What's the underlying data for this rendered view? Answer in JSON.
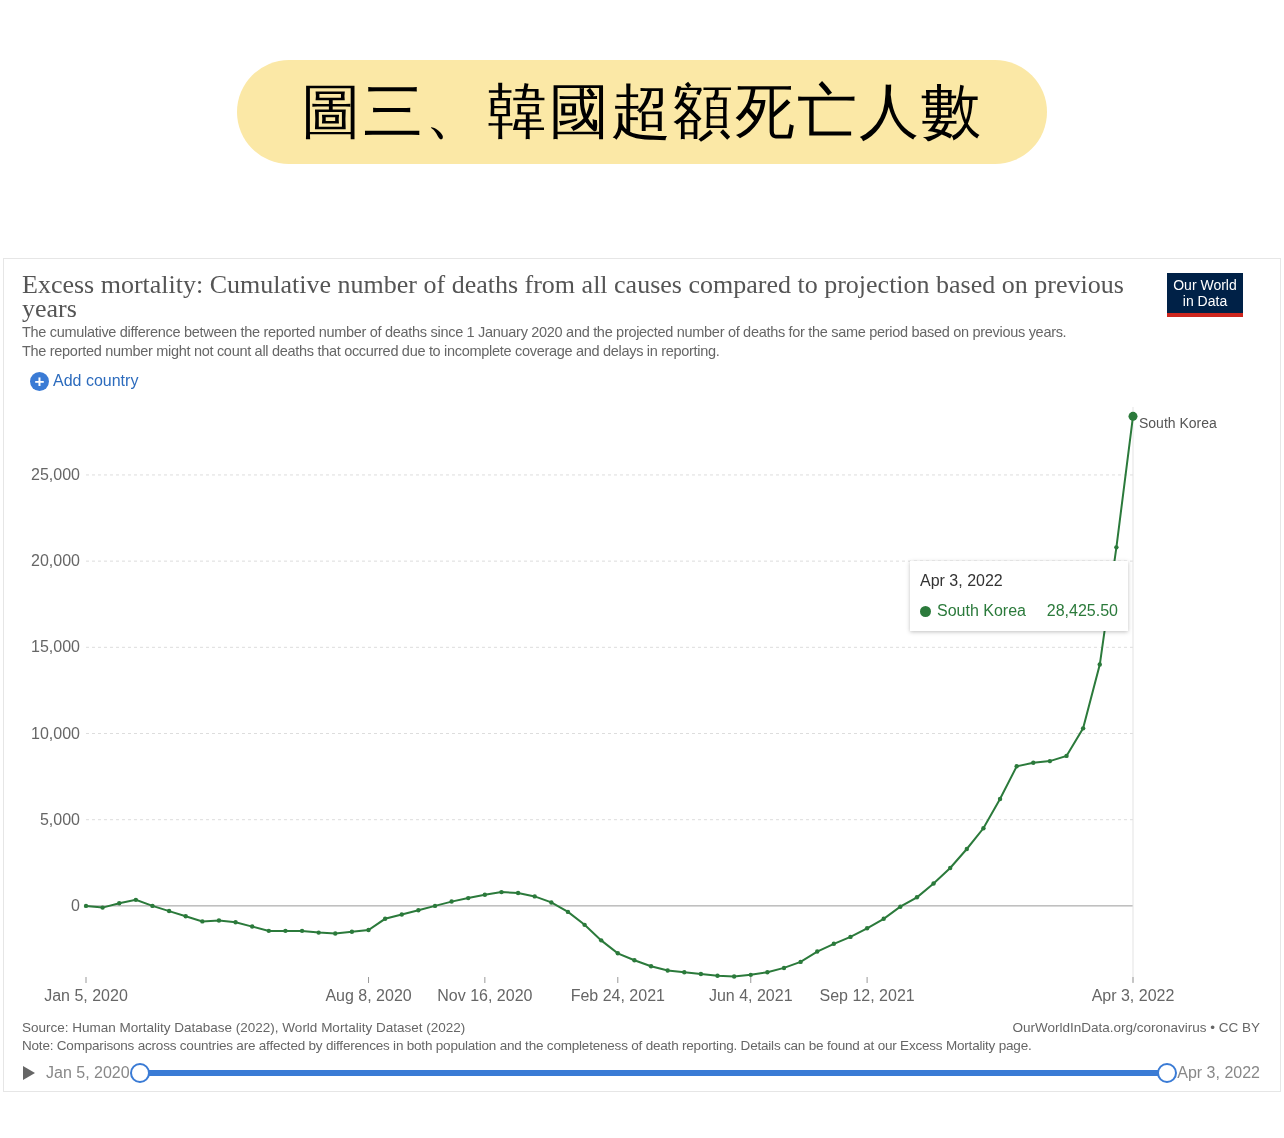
{
  "banner": {
    "title": "圖三、韓國超額死亡人數"
  },
  "chart_card": {
    "title": "Excess mortality: Cumulative number of deaths from all causes compared to projection based on previous years",
    "logo_lines": [
      "Our World",
      "in Data"
    ],
    "subtitle_lines": [
      "The cumulative difference between the reported number of deaths since 1 January 2020 and the projected number of deaths for the same period based on previous years.",
      "The reported number might not count all deaths that occurred due to incomplete coverage and delays in reporting."
    ],
    "add_button": {
      "icon": "+",
      "label": "Add country"
    },
    "chart_data": {
      "type": "line",
      "categories": [
        "Jan 5, 2020",
        null,
        null,
        null,
        null,
        null,
        null,
        null,
        null,
        null,
        null,
        null,
        null,
        null,
        null,
        null,
        null,
        "Aug 8, 2020",
        null,
        null,
        null,
        null,
        null,
        null,
        "Nov 16, 2020",
        null,
        null,
        null,
        null,
        null,
        null,
        null,
        "Feb 24, 2021",
        null,
        null,
        null,
        null,
        null,
        null,
        null,
        "Jun 4, 2021",
        null,
        null,
        null,
        null,
        null,
        null,
        "Sep 12, 2021",
        null,
        null,
        null,
        null,
        null,
        null,
        null,
        null,
        null,
        null,
        null,
        null,
        null,
        null,
        null,
        "Apr 3, 2022"
      ],
      "series": [
        {
          "name": "South Korea",
          "color": "#2b7a3b",
          "values": [
            0,
            -100,
            150,
            350,
            0,
            -300,
            -600,
            -900,
            -850,
            -950,
            -1200,
            -1450,
            -1450,
            -1450,
            -1550,
            -1600,
            -1500,
            -1400,
            -750,
            -500,
            -250,
            0,
            250,
            450,
            650,
            800,
            750,
            550,
            200,
            -350,
            -1100,
            -2000,
            -2750,
            -3150,
            -3500,
            -3750,
            -3850,
            -3950,
            -4050,
            -4100,
            -4000,
            -3850,
            -3600,
            -3250,
            -2650,
            -2200,
            -1800,
            -1300,
            -750,
            -50,
            500,
            1300,
            2200,
            3300,
            4500,
            6200,
            8100,
            8300,
            8400,
            8700,
            10300,
            14000,
            20800,
            28400
          ]
        }
      ],
      "ylim": [
        -4300,
        29000
      ],
      "grid": true,
      "yticks": [
        {
          "value": 0,
          "label": "0"
        },
        {
          "value": 5000,
          "label": "5,000"
        },
        {
          "value": 10000,
          "label": "10,000"
        },
        {
          "value": 15000,
          "label": "15,000"
        },
        {
          "value": 20000,
          "label": "20,000"
        },
        {
          "value": 25000,
          "label": "25,000"
        }
      ]
    },
    "tooltip": {
      "date": "Apr 3, 2022",
      "series": "South Korea",
      "value": "28,425.50"
    },
    "source": "Source: Human Mortality Database (2022), World Mortality Dataset (2022)",
    "link": "OurWorldInData.org/coronavirus • CC BY",
    "note": "Note: Comparisons across countries are affected by differences in both population and the completeness of death reporting. Details can be found at our Excess Mortality page.",
    "timeline": {
      "start_label": "Jan 5, 2020",
      "end_label": "Apr 3, 2022",
      "handles": [
        {
          "level": 0
        },
        {
          "level": 1
        }
      ]
    }
  }
}
